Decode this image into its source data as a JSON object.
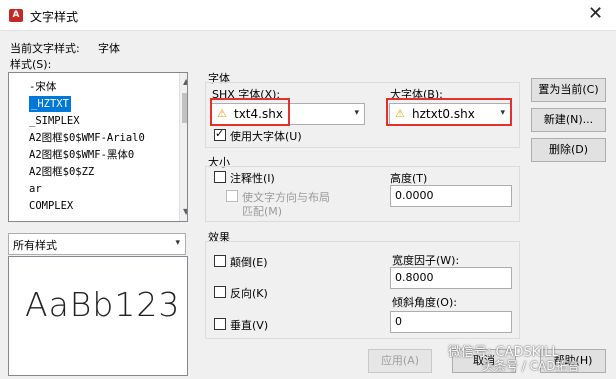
{
  "window": {
    "title": "文字样式",
    "app_icon": "A",
    "close_glyph": "✕"
  },
  "current_style": {
    "label": "当前文字样式:",
    "value": "字体"
  },
  "styles": {
    "label": "样式(S):",
    "items": [
      "-宋体",
      "_HZTXT",
      "_SIMPLEX",
      "A2图框$0$WMF-Arial0",
      "A2图框$0$WMF-黑体0",
      "A2图框$0$ZZ",
      "ar",
      "COMPLEX"
    ],
    "selected_index": 1
  },
  "filter": {
    "value": "所有样式"
  },
  "preview": {
    "text": "AaBb123"
  },
  "font": {
    "group_label": "字体",
    "shx_label": "SHX 字体(X):",
    "shx_value": "txt4.shx",
    "big_label": "大字体(B):",
    "big_value": "hztxt0.shx",
    "use_bigfont_label": "使用大字体(U)",
    "use_bigfont_checked": true
  },
  "size": {
    "group_label": "大小",
    "annotative_label": "注释性(I)",
    "match_orient_label_1": "使文字方向与布局",
    "match_orient_label_2": "匹配(M)",
    "height_label": "高度(T)",
    "height_value": "0.0000"
  },
  "effects": {
    "group_label": "效果",
    "upside_down_label": "颠倒(E)",
    "backwards_label": "反向(K)",
    "vertical_label": "垂直(V)",
    "width_factor_label": "宽度因子(W):",
    "width_factor_value": "0.8000",
    "oblique_label": "倾斜角度(O):",
    "oblique_value": "0"
  },
  "buttons": {
    "set_current": "置为当前(C)",
    "new": "新建(N)...",
    "delete": "删除(D)",
    "apply": "应用(A)",
    "cancel": "取消",
    "help": "帮助(H)"
  },
  "watermark": {
    "line1": "微信号: CADSKILL",
    "line2": "头条号 / CAD拓言"
  },
  "icons": {
    "dropdown": "▾",
    "warning": "⚠"
  }
}
